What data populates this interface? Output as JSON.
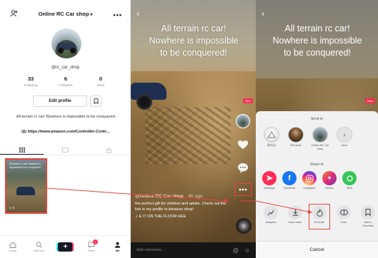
{
  "profile": {
    "title": "Online RC Car shop",
    "title_caret": "▾",
    "menu_glyph": "•••",
    "handle": "@rc_car_shop",
    "stats": [
      {
        "num": "33",
        "label": "Following"
      },
      {
        "num": "6",
        "label": "Followers"
      },
      {
        "num": "0",
        "label": "Likes"
      }
    ],
    "edit_label": "Edit profile",
    "bio": "All terrain rc car! Nowhere is impossible to be conquered.",
    "link": "https://www.amazon.com/Controller-Contr...",
    "link_icon": "link-icon",
    "video_thumb": {
      "overlay_text": "All terrain rc car! Nowhere is impossible to be conquered!",
      "plays": "0"
    },
    "nav": [
      {
        "label": "Home",
        "icon": "home-icon"
      },
      {
        "label": "Discover",
        "icon": "search-icon"
      },
      {
        "label": "",
        "icon": "plus-icon"
      },
      {
        "label": "Inbox",
        "icon": "inbox-icon",
        "badge": "2"
      },
      {
        "label": "Me",
        "icon": "person-icon"
      }
    ]
  },
  "video": {
    "headline_1": "All terrain rc car!",
    "headline_2": "Nowhere is impossible",
    "headline_3": "to be conquered!",
    "new_tag": "New",
    "username": "@Online RC Car shop",
    "ago": "· 6h ago",
    "desc": "the perfect gift for children and adults. Check out the link in my profile to Amazon shop!",
    "music": "♫ E IT ON THE FLOOR HEE",
    "comment_placeholder": "Add comment...",
    "comment_icons": [
      "@",
      "☺"
    ]
  },
  "share": {
    "headline_1": "All terrain rc car!",
    "headline_2": "Nowhere is impossible",
    "headline_3": "to be conquered!",
    "new_tag": "New",
    "send_to_label": "Send to",
    "contacts": [
      {
        "label": "陈冰洁"
      },
      {
        "label": "Bill Quan"
      },
      {
        "label": "Online RC Car shop"
      },
      {
        "label": "More"
      }
    ],
    "share_to_label": "Share to",
    "apps": [
      {
        "label": "Message",
        "color": "#fe2c55"
      },
      {
        "label": "Facebook",
        "color": "#1877f2"
      },
      {
        "label": "Instagram",
        "color": "#d6249f"
      },
      {
        "label": "Stories",
        "color": "#a033d6"
      },
      {
        "label": "SMS",
        "color": "#34c759"
      }
    ],
    "actions": [
      {
        "label": "Analytics"
      },
      {
        "label": "Save video"
      },
      {
        "label": "Promote"
      },
      {
        "label": "Duet"
      },
      {
        "label": "Add to Favorites"
      }
    ],
    "cancel_label": "Cancel"
  },
  "colors": {
    "tiktok_red": "#fe2c55",
    "annotation_red": "#e8453c",
    "tiktok_cyan": "#25f4ee"
  }
}
